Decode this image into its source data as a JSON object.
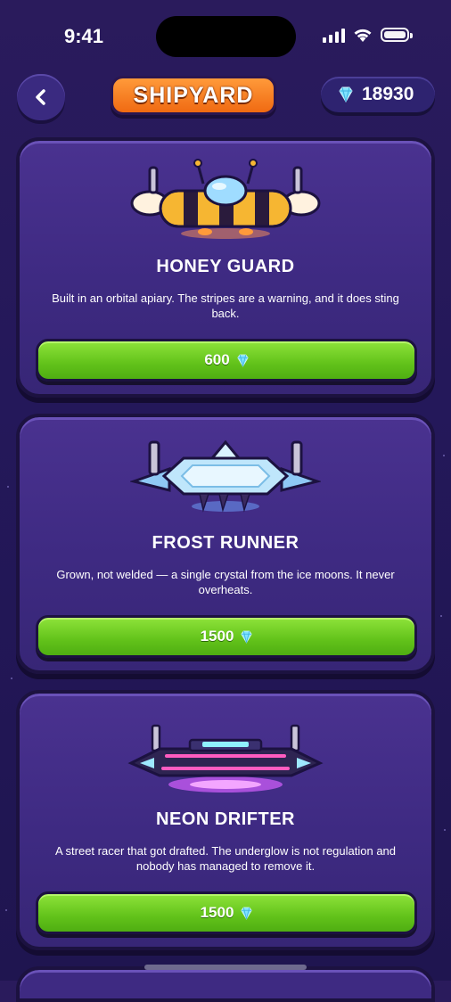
{
  "status_bar": {
    "time": "9:41"
  },
  "header": {
    "title": "SHIPYARD",
    "gems": "18930"
  },
  "ships": [
    {
      "name": "HONEY GUARD",
      "description": "Built in an orbital apiary. The stripes are a warning, and it does sting back.",
      "price": "600"
    },
    {
      "name": "FROST RUNNER",
      "description": "Grown, not welded — a single crystal from the ice moons. It never overheats.",
      "price": "1500"
    },
    {
      "name": "NEON DRIFTER",
      "description": "A street racer that got drafted. The underglow is not regulation and nobody has managed to remove it.",
      "price": "1500"
    }
  ],
  "colors": {
    "accent_orange": "#f07a1f",
    "buy_green": "#6ccd22",
    "background": "#24185a",
    "gem": "#7fe3ff"
  },
  "icons": [
    "back-chevron-icon",
    "gem-icon",
    "signal-icon",
    "wifi-icon",
    "battery-icon"
  ]
}
